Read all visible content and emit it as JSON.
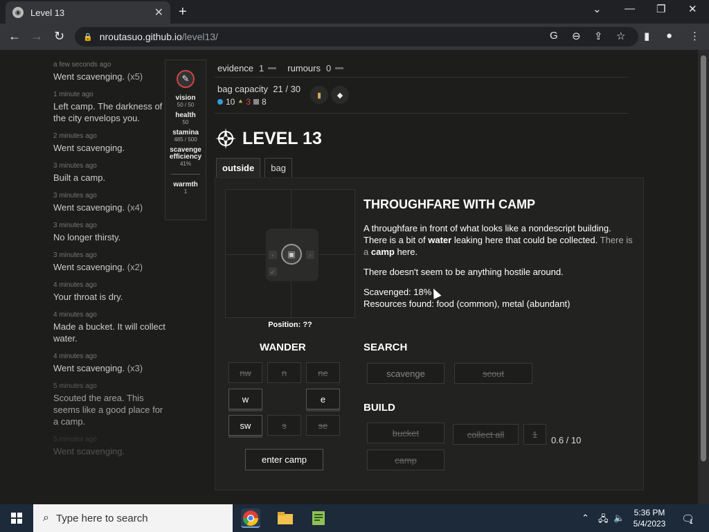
{
  "browser": {
    "tab_title": "Level 13",
    "url_host": "nroutasuo.github.io",
    "url_path": "/level13/"
  },
  "log": [
    {
      "time": "a few seconds ago",
      "msg": "Went scavenging.",
      "count": "(x5)"
    },
    {
      "time": "1 minute ago",
      "msg": "Left camp. The darkness of the city envelops you.",
      "count": ""
    },
    {
      "time": "2 minutes ago",
      "msg": "Went scavenging.",
      "count": ""
    },
    {
      "time": "3 minutes ago",
      "msg": "Built a camp.",
      "count": ""
    },
    {
      "time": "3 minutes ago",
      "msg": "Went scavenging.",
      "count": "(x4)"
    },
    {
      "time": "3 minutes ago",
      "msg": "No longer thirsty.",
      "count": ""
    },
    {
      "time": "3 minutes ago",
      "msg": "Went scavenging.",
      "count": "(x2)"
    },
    {
      "time": "4 minutes ago",
      "msg": "Your throat is dry.",
      "count": ""
    },
    {
      "time": "4 minutes ago",
      "msg": "Made a bucket. It will collect water.",
      "count": ""
    },
    {
      "time": "4 minutes ago",
      "msg": "Went scavenging.",
      "count": "(x3)"
    },
    {
      "time": "5 minutes ago",
      "msg": "Scouted the area. This seems like a good place for a camp.",
      "count": ""
    },
    {
      "time": "5 minutes ago",
      "msg": "Went scavenging.",
      "count": ""
    }
  ],
  "stats": {
    "vision_label": "vision",
    "vision_val": "50 / 50",
    "health_label": "health",
    "health_val": "50",
    "stamina_label": "stamina",
    "stamina_val": "485 / 500",
    "scav_label": "scavenge efficiency",
    "scav_val": "41%",
    "warmth_label": "warmth",
    "warmth_val": "1"
  },
  "topbar": {
    "evidence_label": "evidence",
    "evidence_val": "1",
    "rumours_label": "rumours",
    "rumours_val": "0"
  },
  "bag": {
    "capacity_label": "bag capacity",
    "capacity_used": "21",
    "capacity_sep": "/",
    "capacity_max": "30",
    "water": "10",
    "food": "3",
    "metal": "8"
  },
  "game": {
    "title": "LEVEL 13",
    "tab_outside": "outside",
    "tab_bag": "bag",
    "position": "Position: ??",
    "location_title": "THROUGHFARE WITH CAMP",
    "desc_1a": "A throughfare in front of what looks like a nondescript building.",
    "desc_1b": "There is a bit of",
    "desc_1c": "water",
    "desc_1d": "leaking here that could be collected.",
    "desc_1e": "There is a",
    "desc_1f": "camp",
    "desc_1g": "here.",
    "desc_2": "There doesn't seem to be anything hostile around.",
    "scavenged": "Scavenged: 18%",
    "resources": "Resources found: food (common), metal (abundant)"
  },
  "wander": {
    "title": "WANDER",
    "nw": "nw",
    "n": "n",
    "ne": "ne",
    "w": "w",
    "e": "e",
    "sw": "sw",
    "s": "s",
    "se": "se",
    "enter_camp": "enter camp"
  },
  "search": {
    "title": "SEARCH",
    "scavenge": "scavenge",
    "scout": "scout"
  },
  "build": {
    "title": "BUILD",
    "bucket": "bucket",
    "collect_all": "collect all",
    "one": "1",
    "progress": "0.6 / 10",
    "camp": "camp"
  },
  "taskbar": {
    "search_placeholder": "Type here to search",
    "time": "5:36 PM",
    "date": "5/4/2023",
    "notif_count": "1"
  },
  "colors": {
    "water": "#3a9ad9",
    "food": "#c9b458",
    "food_count": "#d04a4a"
  }
}
